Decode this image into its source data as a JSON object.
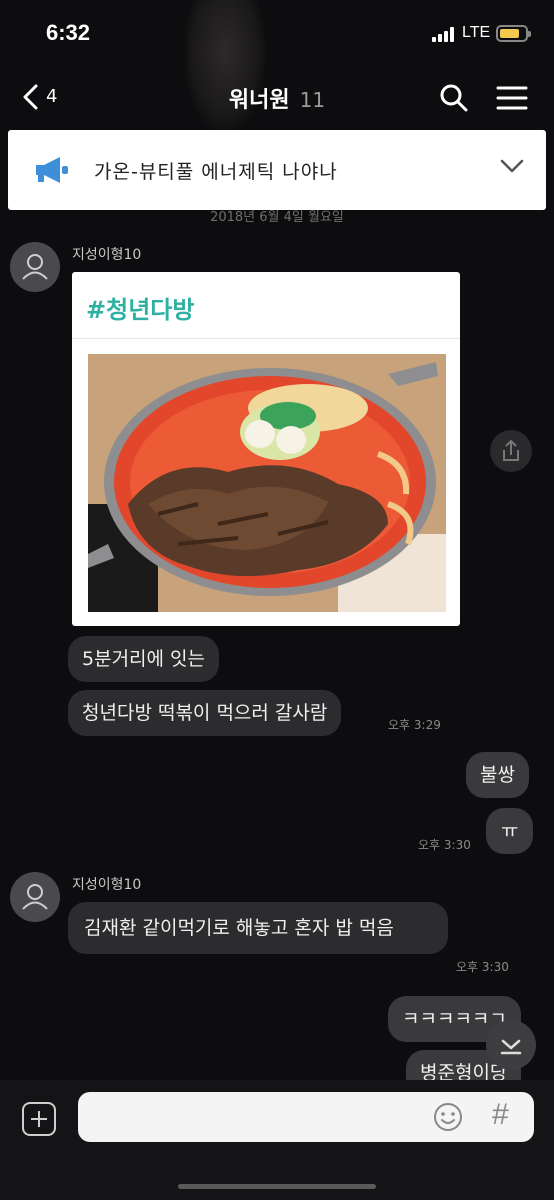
{
  "status": {
    "time": "6:32",
    "network": "LTE"
  },
  "header": {
    "back_count": "4",
    "title": "워너원",
    "member_count": "11"
  },
  "notice": {
    "text": "가온-뷰티풀 에너제틱 나야나"
  },
  "date_divider": "2018년 6월 4일 월요일",
  "messages": [
    {
      "sender": "지성이형10",
      "card_tag": "#청년다방"
    },
    {
      "text": "5분거리에 잇는"
    },
    {
      "text": "청년다방 떡볶이 먹으러 갈사람",
      "time": "오후 3:29"
    },
    {
      "text": "불쌍",
      "mine": true
    },
    {
      "text": "ㅠ",
      "mine": true,
      "time": "오후 3:30"
    },
    {
      "sender": "지성이형10",
      "text": "김재환 같이먹기로 해놓고 혼자 밥  먹음",
      "time": "오후 3:30"
    },
    {
      "text": "ㅋㅋㅋㅋㅋㄱ",
      "mine": true
    },
    {
      "text": "병준형이당",
      "mine": true
    }
  ],
  "input": {
    "placeholder": ""
  },
  "colors": {
    "background": "#0d0d0f",
    "tag": "#2eb0a3",
    "notice_icon": "#3d8fd9",
    "battery": "#f2c94c"
  }
}
